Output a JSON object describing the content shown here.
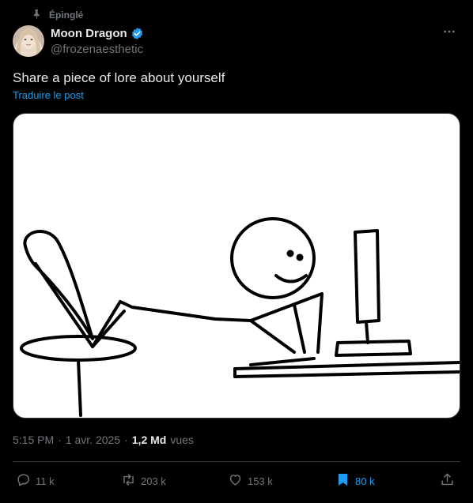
{
  "post": {
    "pinned_label": "Épinglé",
    "author": {
      "display_name": "Moon Dragon",
      "handle": "@frozenaesthetic",
      "verified": true
    },
    "text": "Share a piece of lore about yourself",
    "translate_label": "Traduire le post",
    "time": "5:15 PM",
    "separator": "·",
    "date": "1 avr. 2025",
    "views_count": "1,2 Md",
    "views_label": "vues"
  },
  "actions": {
    "replies": "11 k",
    "reposts": "203 k",
    "likes": "153 k",
    "bookmarks": "80 k"
  },
  "icons": {
    "pin": "pin-icon",
    "verified": "verified-badge-icon",
    "more": "more-icon",
    "reply": "reply-icon",
    "repost": "repost-icon",
    "like": "heart-icon",
    "bookmark": "bookmark-icon",
    "share": "share-icon"
  },
  "colors": {
    "background": "#000000",
    "primary_text": "#e7e9ea",
    "secondary_text": "#71767b",
    "accent": "#1d9bf0",
    "divider": "#2f3336"
  }
}
